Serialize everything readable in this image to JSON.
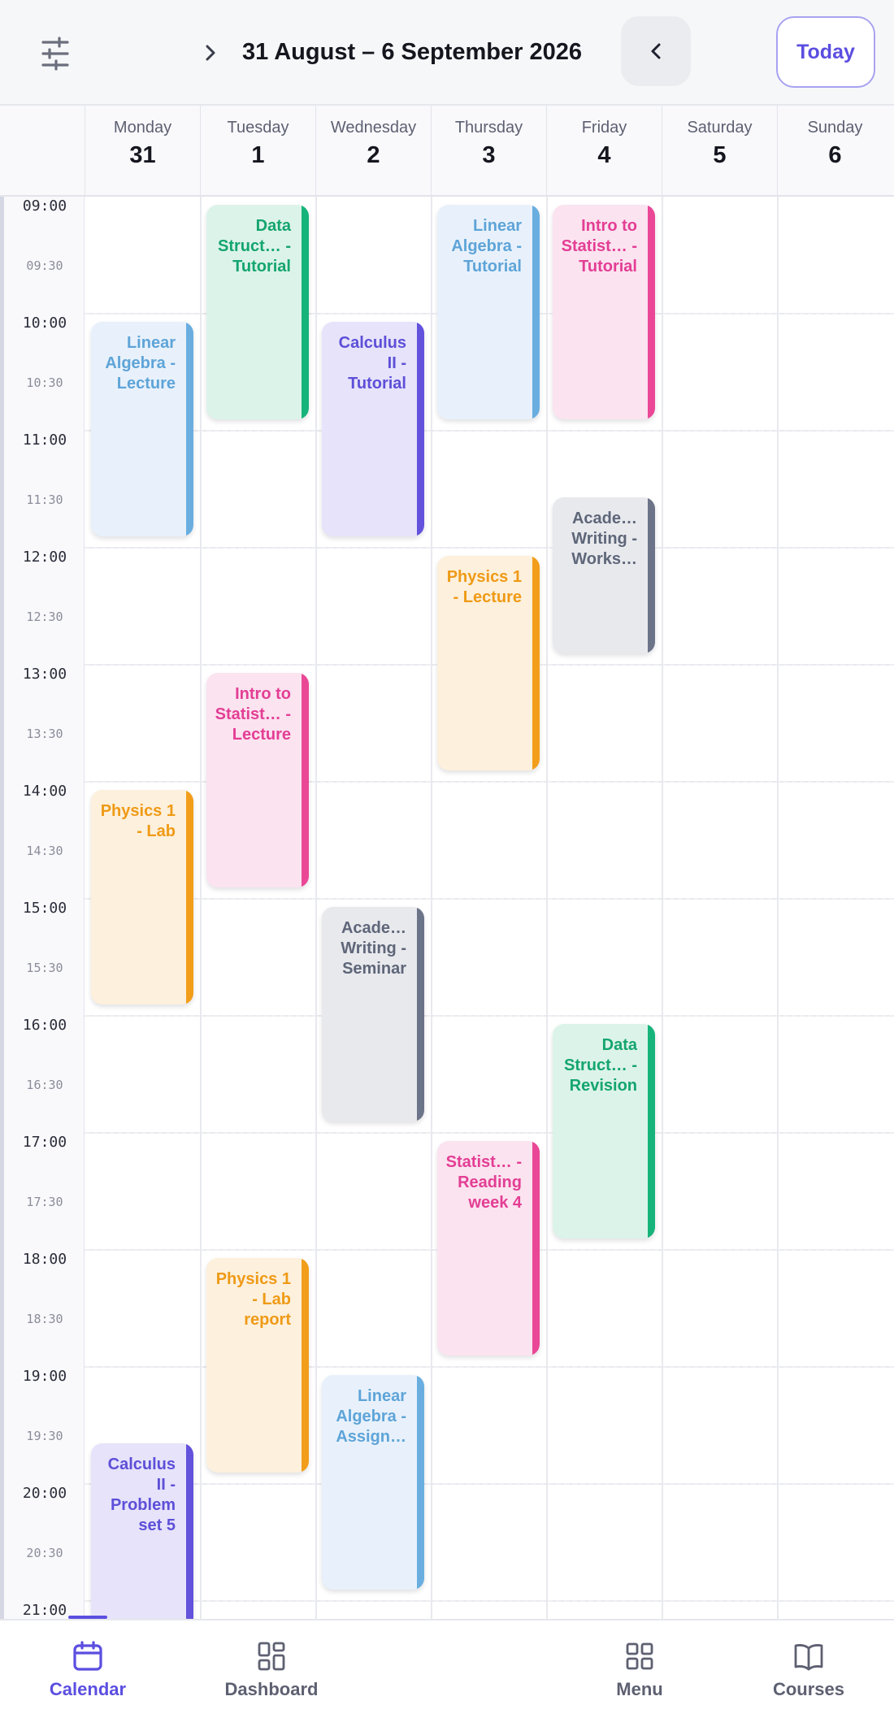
{
  "header": {
    "date_range": "31 August – 6 September 2026",
    "today_label": "Today",
    "filter_icon": "sliders-icon",
    "next_icon": "chevron-right-icon",
    "prev_icon": "chevron-left-icon"
  },
  "days": [
    {
      "name": "Monday",
      "num": "31"
    },
    {
      "name": "Tuesday",
      "num": "1"
    },
    {
      "name": "Wednesday",
      "num": "2"
    },
    {
      "name": "Thursday",
      "num": "3"
    },
    {
      "name": "Friday",
      "num": "4"
    },
    {
      "name": "Saturday",
      "num": "5"
    },
    {
      "name": "Sunday",
      "num": "6"
    }
  ],
  "hours": [
    "09:00",
    "10:00",
    "11:00",
    "12:00",
    "13:00",
    "14:00",
    "15:00",
    "16:00",
    "17:00",
    "18:00",
    "19:00",
    "20:00",
    "21:00"
  ],
  "half_hours": [
    "09:30",
    "10:30",
    "11:30",
    "12:30",
    "13:30",
    "14:30",
    "15:30",
    "16:30",
    "17:30",
    "18:30",
    "19:30",
    "20:30"
  ],
  "colors": {
    "accent": "#5b4ee0",
    "green": "#16b37a",
    "blue": "#6aaee0",
    "pink": "#ea4796",
    "purple": "#6352dc",
    "orange": "#f29e1a",
    "gray": "#6c7489"
  },
  "events": [
    {
      "day": 0,
      "start": "10:00",
      "end": "11:50",
      "color": "blue",
      "title": "Linear Algebra - Lecture"
    },
    {
      "day": 0,
      "start": "14:00",
      "end": "15:50",
      "color": "orange",
      "title": "Physics 1 - Lab"
    },
    {
      "day": 0,
      "start": "19:35",
      "end": "21:15",
      "color": "purple",
      "title": "Calculus II - Problem set 5"
    },
    {
      "day": 1,
      "start": "09:00",
      "end": "10:50",
      "color": "green",
      "title": "Data Struct… - Tutorial"
    },
    {
      "day": 1,
      "start": "13:00",
      "end": "14:50",
      "color": "pink",
      "title": "Intro to Statist… - Lecture"
    },
    {
      "day": 1,
      "start": "18:00",
      "end": "19:50",
      "color": "orange",
      "title": "Physics 1 - Lab report"
    },
    {
      "day": 2,
      "start": "10:00",
      "end": "11:50",
      "color": "purple",
      "title": "Calculus II - Tutorial"
    },
    {
      "day": 2,
      "start": "15:00",
      "end": "16:50",
      "color": "gray",
      "title": "Acade… Writing - Seminar"
    },
    {
      "day": 2,
      "start": "19:00",
      "end": "20:50",
      "color": "blue",
      "title": "Linear Algebra - Assign…"
    },
    {
      "day": 3,
      "start": "09:00",
      "end": "10:50",
      "color": "blue",
      "title": "Linear Algebra - Tutorial"
    },
    {
      "day": 3,
      "start": "12:00",
      "end": "13:50",
      "color": "orange",
      "title": "Physics 1 - Lecture"
    },
    {
      "day": 3,
      "start": "17:00",
      "end": "18:50",
      "color": "pink",
      "title": "Statist… - Reading week 4"
    },
    {
      "day": 4,
      "start": "09:00",
      "end": "10:50",
      "color": "pink",
      "title": "Intro to Statist… - Tutorial"
    },
    {
      "day": 4,
      "start": "11:30",
      "end": "12:50",
      "color": "gray",
      "title": "Acade… Writing - Works…"
    },
    {
      "day": 4,
      "start": "16:00",
      "end": "17:50",
      "color": "green",
      "title": "Data Struct… - Revision"
    }
  ],
  "nav": [
    {
      "label": "Calendar",
      "icon": "calendar-icon",
      "active": true
    },
    {
      "label": "Dashboard",
      "icon": "dashboard-icon",
      "active": false
    },
    {
      "label": "Menu",
      "icon": "menu-grid-icon",
      "active": false
    },
    {
      "label": "Courses",
      "icon": "book-icon",
      "active": false
    }
  ]
}
